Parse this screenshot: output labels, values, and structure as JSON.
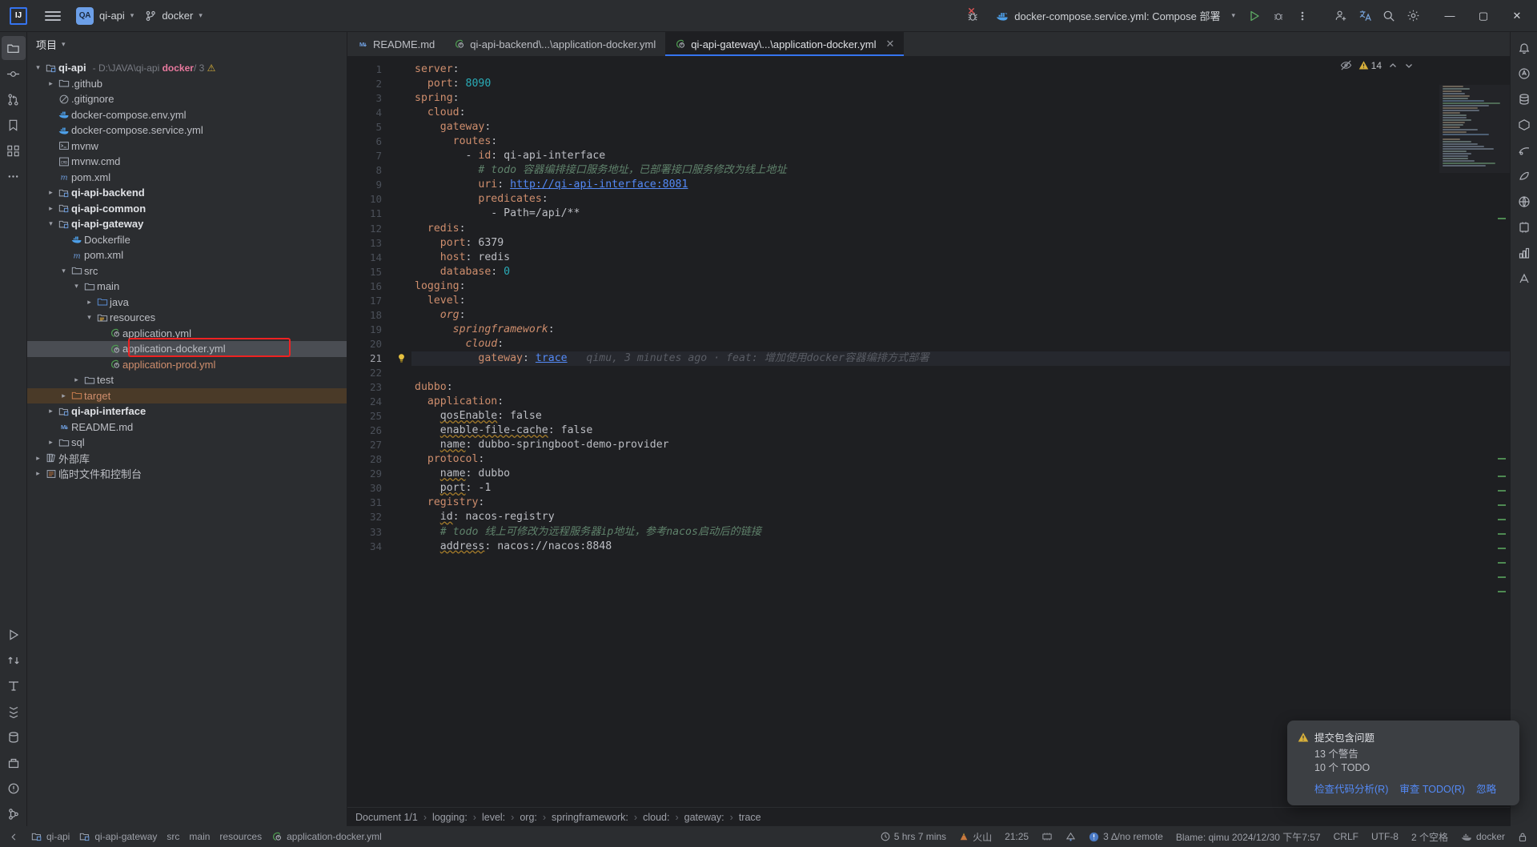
{
  "titlebar": {
    "logo": "IJ",
    "menu_icon": "hamburger-menu-icon",
    "project_chip": "QA",
    "project_name": "qi-api",
    "branch_name": "docker",
    "run_config": "docker-compose.service.yml: Compose 部署",
    "run_icon": "run-icon",
    "debug_icon": "debug-icon",
    "more_icon": "more-vertical-icon",
    "bug_icon": "debug-error-icon",
    "add_user_icon": "add-user-icon",
    "translate_icon": "translate-icon",
    "search_icon": "search-icon",
    "settings_icon": "settings-gear-icon",
    "minimize": "—",
    "maximize": "▢",
    "close": "✕"
  },
  "left_rail": [
    {
      "name": "project-tool-icon",
      "glyph": "folder"
    },
    {
      "name": "commit-tool-icon",
      "glyph": "commit"
    },
    {
      "name": "pull-requests-icon",
      "glyph": "pr"
    },
    {
      "name": "bookmarks-icon",
      "glyph": "bookmark"
    },
    {
      "name": "structure-icon",
      "glyph": "structure"
    },
    {
      "name": "more-tools-icon",
      "glyph": "dots"
    },
    {
      "name": "run-tool-icon",
      "glyph": "run"
    },
    {
      "name": "version-control-icon",
      "glyph": "vcs"
    },
    {
      "name": "terminal-tool-icon",
      "glyph": "t"
    },
    {
      "name": "services-icon",
      "glyph": "services"
    },
    {
      "name": "database-icon",
      "glyph": "db"
    },
    {
      "name": "build-icon",
      "glyph": "build"
    },
    {
      "name": "problems-icon",
      "glyph": "problems"
    },
    {
      "name": "git-icon",
      "glyph": "git"
    }
  ],
  "right_rail": [
    {
      "name": "notifications-icon",
      "glyph": "bell"
    },
    {
      "name": "ai-assistant-icon",
      "glyph": "ai"
    },
    {
      "name": "database-tool-icon",
      "glyph": "db"
    },
    {
      "name": "maven-icon",
      "glyph": "m"
    },
    {
      "name": "gradle-icon",
      "glyph": "g"
    },
    {
      "name": "bean-icon",
      "glyph": "bean"
    },
    {
      "name": "endpoints-icon",
      "glyph": "endpoint"
    },
    {
      "name": "plugins-icon",
      "glyph": "plugin"
    },
    {
      "name": "profiler-icon",
      "glyph": "prof"
    },
    {
      "name": "font-size-icon",
      "glyph": "A"
    }
  ],
  "project_panel": {
    "title": "项目",
    "tree": [
      {
        "depth": 0,
        "arrow": "down",
        "icon": "module-icon",
        "label": "qi-api",
        "style": "bold",
        "path_prefix": "- D:\\JAVA\\qi-api",
        "path_branch": "docker",
        "path_suffix": "/ 3",
        "path_warn": "⚠"
      },
      {
        "depth": 1,
        "arrow": "right",
        "icon": "folder-icon",
        "label": ".github",
        "style": ""
      },
      {
        "depth": 1,
        "arrow": "none",
        "icon": "gitignore-icon",
        "label": ".gitignore",
        "style": ""
      },
      {
        "depth": 1,
        "arrow": "none",
        "icon": "docker-icon",
        "label": "docker-compose.env.yml",
        "style": ""
      },
      {
        "depth": 1,
        "arrow": "none",
        "icon": "docker-icon",
        "label": "docker-compose.service.yml",
        "style": ""
      },
      {
        "depth": 1,
        "arrow": "none",
        "icon": "shell-icon",
        "label": "mvnw",
        "style": ""
      },
      {
        "depth": 1,
        "arrow": "none",
        "icon": "cmd-icon",
        "label": "mvnw.cmd",
        "style": ""
      },
      {
        "depth": 1,
        "arrow": "none",
        "icon": "maven-pom-icon",
        "label": "pom.xml",
        "style": ""
      },
      {
        "depth": 1,
        "arrow": "right",
        "icon": "module-icon",
        "label": "qi-api-backend",
        "style": "bold"
      },
      {
        "depth": 1,
        "arrow": "right",
        "icon": "module-icon",
        "label": "qi-api-common",
        "style": "bold"
      },
      {
        "depth": 1,
        "arrow": "down",
        "icon": "module-icon",
        "label": "qi-api-gateway",
        "style": "bold"
      },
      {
        "depth": 2,
        "arrow": "none",
        "icon": "docker-icon",
        "label": "Dockerfile",
        "style": ""
      },
      {
        "depth": 2,
        "arrow": "none",
        "icon": "maven-pom-icon",
        "label": "pom.xml",
        "style": ""
      },
      {
        "depth": 2,
        "arrow": "down",
        "icon": "folder-icon",
        "label": "src",
        "style": ""
      },
      {
        "depth": 3,
        "arrow": "down",
        "icon": "folder-icon",
        "label": "main",
        "style": ""
      },
      {
        "depth": 4,
        "arrow": "right",
        "icon": "source-folder-icon",
        "label": "java",
        "style": ""
      },
      {
        "depth": 4,
        "arrow": "down",
        "icon": "resource-folder-icon",
        "label": "resources",
        "style": ""
      },
      {
        "depth": 5,
        "arrow": "none",
        "icon": "spring-yml-icon",
        "label": "application.yml",
        "style": ""
      },
      {
        "depth": 5,
        "arrow": "none",
        "icon": "spring-yml-icon",
        "label": "application-docker.yml",
        "style": "selected"
      },
      {
        "depth": 5,
        "arrow": "none",
        "icon": "spring-yml-icon",
        "label": "application-prod.yml",
        "style": "orange"
      },
      {
        "depth": 3,
        "arrow": "right",
        "icon": "folder-icon",
        "label": "test",
        "style": ""
      },
      {
        "depth": 2,
        "arrow": "right",
        "icon": "target-folder-icon",
        "label": "target",
        "style": "target"
      },
      {
        "depth": 1,
        "arrow": "right",
        "icon": "module-icon",
        "label": "qi-api-interface",
        "style": "bold"
      },
      {
        "depth": 1,
        "arrow": "none",
        "icon": "markdown-icon",
        "label": "README.md",
        "style": ""
      },
      {
        "depth": 1,
        "arrow": "right",
        "icon": "folder-icon",
        "label": "sql",
        "style": ""
      },
      {
        "depth": 0,
        "arrow": "right",
        "icon": "library-icon",
        "label": "外部库",
        "style": ""
      },
      {
        "depth": 0,
        "arrow": "right",
        "icon": "scratches-icon",
        "label": "临时文件和控制台",
        "style": ""
      }
    ]
  },
  "editor": {
    "tabs": [
      {
        "label": "README.md",
        "icon": "markdown-icon",
        "active": false,
        "closable": false
      },
      {
        "label": "qi-api-backend\\...\\application-docker.yml",
        "icon": "spring-yml-icon",
        "active": false,
        "closable": false
      },
      {
        "label": "qi-api-gateway\\...\\application-docker.yml",
        "icon": "spring-yml-icon",
        "active": true,
        "closable": true
      }
    ],
    "inspection": {
      "eye_icon": "inspection-eye-off-icon",
      "warning_icon": "warning-triangle-icon",
      "warning_count": "14",
      "up_icon": "chevron-up-icon",
      "down_icon": "chevron-down-icon"
    },
    "current_line": 21,
    "blame_text": "qimu, 3 minutes ago · feat: 增加使用docker容器编排方式部署",
    "lines": [
      {
        "n": 1,
        "tokens": [
          {
            "t": "server",
            "c": "key"
          },
          {
            "t": ":",
            "c": "plain"
          }
        ]
      },
      {
        "n": 2,
        "tokens": [
          {
            "t": "  port",
            "c": "key"
          },
          {
            "t": ": ",
            "c": "plain"
          },
          {
            "t": "8090",
            "c": "num"
          }
        ]
      },
      {
        "n": 3,
        "tokens": [
          {
            "t": "spring",
            "c": "key"
          },
          {
            "t": ":",
            "c": "plain"
          }
        ]
      },
      {
        "n": 4,
        "tokens": [
          {
            "t": "  cloud",
            "c": "key"
          },
          {
            "t": ":",
            "c": "plain"
          }
        ]
      },
      {
        "n": 5,
        "tokens": [
          {
            "t": "    gateway",
            "c": "key"
          },
          {
            "t": ":",
            "c": "plain"
          }
        ]
      },
      {
        "n": 6,
        "tokens": [
          {
            "t": "      routes",
            "c": "key"
          },
          {
            "t": ":",
            "c": "plain"
          }
        ]
      },
      {
        "n": 7,
        "tokens": [
          {
            "t": "        - ",
            "c": "plain"
          },
          {
            "t": "id",
            "c": "link-key"
          },
          {
            "t": ": qi-api-interface",
            "c": "plain"
          }
        ]
      },
      {
        "n": 8,
        "tokens": [
          {
            "t": "          # todo 容器编排接口服务地址，已部署接口服务修改为线上地址",
            "c": "comment"
          }
        ]
      },
      {
        "n": 9,
        "tokens": [
          {
            "t": "          ",
            "c": "plain"
          },
          {
            "t": "uri",
            "c": "key"
          },
          {
            "t": ": ",
            "c": "plain"
          },
          {
            "t": "http://qi-api-interface:8081",
            "c": "link"
          }
        ]
      },
      {
        "n": 10,
        "tokens": [
          {
            "t": "          predicates",
            "c": "key"
          },
          {
            "t": ":",
            "c": "plain"
          }
        ]
      },
      {
        "n": 11,
        "tokens": [
          {
            "t": "            - Path=/api/**",
            "c": "plain"
          }
        ]
      },
      {
        "n": 12,
        "tokens": [
          {
            "t": "  redis",
            "c": "key"
          },
          {
            "t": ":",
            "c": "plain"
          }
        ]
      },
      {
        "n": 13,
        "tokens": [
          {
            "t": "    port",
            "c": "key"
          },
          {
            "t": ": ",
            "c": "plain"
          },
          {
            "t": "6379",
            "c": "plain"
          }
        ]
      },
      {
        "n": 14,
        "tokens": [
          {
            "t": "    host",
            "c": "key"
          },
          {
            "t": ": redis",
            "c": "plain"
          }
        ]
      },
      {
        "n": 15,
        "tokens": [
          {
            "t": "    database",
            "c": "key"
          },
          {
            "t": ": ",
            "c": "plain"
          },
          {
            "t": "0",
            "c": "num"
          }
        ]
      },
      {
        "n": 16,
        "tokens": [
          {
            "t": "logging",
            "c": "key"
          },
          {
            "t": ":",
            "c": "plain"
          }
        ]
      },
      {
        "n": 17,
        "tokens": [
          {
            "t": "  level",
            "c": "key"
          },
          {
            "t": ":",
            "c": "plain"
          }
        ]
      },
      {
        "n": 18,
        "tokens": [
          {
            "t": "    org",
            "c": "key-i"
          },
          {
            "t": ":",
            "c": "plain"
          }
        ]
      },
      {
        "n": 19,
        "tokens": [
          {
            "t": "      springframework",
            "c": "key-i"
          },
          {
            "t": ":",
            "c": "plain"
          }
        ]
      },
      {
        "n": 20,
        "tokens": [
          {
            "t": "        cloud",
            "c": "key-i"
          },
          {
            "t": ":",
            "c": "plain"
          }
        ]
      },
      {
        "n": 21,
        "tokens": [
          {
            "t": "          gateway",
            "c": "key"
          },
          {
            "t": ": ",
            "c": "plain"
          },
          {
            "t": "trace",
            "c": "link"
          }
        ],
        "bulb": true,
        "blame": true
      },
      {
        "n": 22,
        "tokens": []
      },
      {
        "n": 23,
        "tokens": [
          {
            "t": "dubbo",
            "c": "key"
          },
          {
            "t": ":",
            "c": "plain"
          }
        ]
      },
      {
        "n": 24,
        "tokens": [
          {
            "t": "  application",
            "c": "key"
          },
          {
            "t": ":",
            "c": "plain"
          }
        ]
      },
      {
        "n": 25,
        "tokens": [
          {
            "t": "    ",
            "c": "plain"
          },
          {
            "t": "qosEnable",
            "c": "warn-key"
          },
          {
            "t": ": false",
            "c": "plain"
          }
        ]
      },
      {
        "n": 26,
        "tokens": [
          {
            "t": "    ",
            "c": "plain"
          },
          {
            "t": "enable-file-cache",
            "c": "warn-key"
          },
          {
            "t": ": false",
            "c": "plain"
          }
        ]
      },
      {
        "n": 27,
        "tokens": [
          {
            "t": "    ",
            "c": "plain"
          },
          {
            "t": "name",
            "c": "warn-key"
          },
          {
            "t": ": dubbo-springboot-demo-provider",
            "c": "plain"
          }
        ]
      },
      {
        "n": 28,
        "tokens": [
          {
            "t": "  protocol",
            "c": "key"
          },
          {
            "t": ":",
            "c": "plain"
          }
        ]
      },
      {
        "n": 29,
        "tokens": [
          {
            "t": "    ",
            "c": "plain"
          },
          {
            "t": "name",
            "c": "warn-key"
          },
          {
            "t": ": dubbo",
            "c": "plain"
          }
        ]
      },
      {
        "n": 30,
        "tokens": [
          {
            "t": "    ",
            "c": "plain"
          },
          {
            "t": "port",
            "c": "warn-key"
          },
          {
            "t": ": -1",
            "c": "plain"
          }
        ]
      },
      {
        "n": 31,
        "tokens": [
          {
            "t": "  registry",
            "c": "key"
          },
          {
            "t": ":",
            "c": "plain"
          }
        ]
      },
      {
        "n": 32,
        "tokens": [
          {
            "t": "    ",
            "c": "plain"
          },
          {
            "t": "id",
            "c": "warn-key"
          },
          {
            "t": ": nacos-registry",
            "c": "plain"
          }
        ]
      },
      {
        "n": 33,
        "tokens": [
          {
            "t": "    # todo 线上可修改为远程服务器ip地址，参考nacos启动后的链接",
            "c": "comment"
          }
        ]
      },
      {
        "n": 34,
        "tokens": [
          {
            "t": "    ",
            "c": "plain"
          },
          {
            "t": "address",
            "c": "warn-key"
          },
          {
            "t": ": nacos://nacos:8848",
            "c": "plain"
          }
        ]
      }
    ]
  },
  "breadcrumb": {
    "document": "Document 1/1",
    "items": [
      "logging:",
      "level:",
      "org:",
      "springframework:",
      "cloud:",
      "gateway:",
      "trace"
    ]
  },
  "statusbar": {
    "left": [
      {
        "name": "project-crumb",
        "icon": "module-icon",
        "label": "qi-api"
      },
      {
        "name": "module-crumb",
        "icon": "module-icon",
        "label": "qi-api-gateway"
      },
      {
        "name": "src-crumb",
        "icon": "",
        "label": "src"
      },
      {
        "name": "main-crumb",
        "icon": "",
        "label": "main"
      },
      {
        "name": "resources-crumb",
        "icon": "",
        "label": "resources"
      },
      {
        "name": "file-crumb",
        "icon": "spring-yml-icon",
        "label": "application-docker.yml"
      }
    ],
    "time_tracker": "5 hrs 7 mins",
    "time_icon": "clock-icon",
    "volcano_label": "火山",
    "volcano_icon": "volcano-icon",
    "clock_value": "21:25",
    "memory_icon": "memory-icon",
    "inspection_icon": "inspection-icon",
    "vcs_branch": "3 ∆/no remote",
    "vcs_icon": "branch-icon",
    "blame": "Blame: qimu 2024/12/30 下午7:57",
    "line_sep": "CRLF",
    "encoding": "UTF-8",
    "indent": "2 个空格",
    "docker": "docker",
    "docker_icon": "docker-icon",
    "lock_icon": "lock-icon",
    "caret": ""
  },
  "notification": {
    "icon": "warning-triangle-icon",
    "title": "提交包含问题",
    "line1": "13 个警告",
    "line2": "10 个 TODO",
    "action1": "检查代码分析(R)",
    "action2": "审查 TODO(R)",
    "action3": "忽略"
  },
  "colors": {
    "accent": "#3574f0",
    "warning": "#d8b03a",
    "highlight_box": "#ee2222",
    "bg": "#2b2d30",
    "editor_bg": "#1e1f22"
  }
}
